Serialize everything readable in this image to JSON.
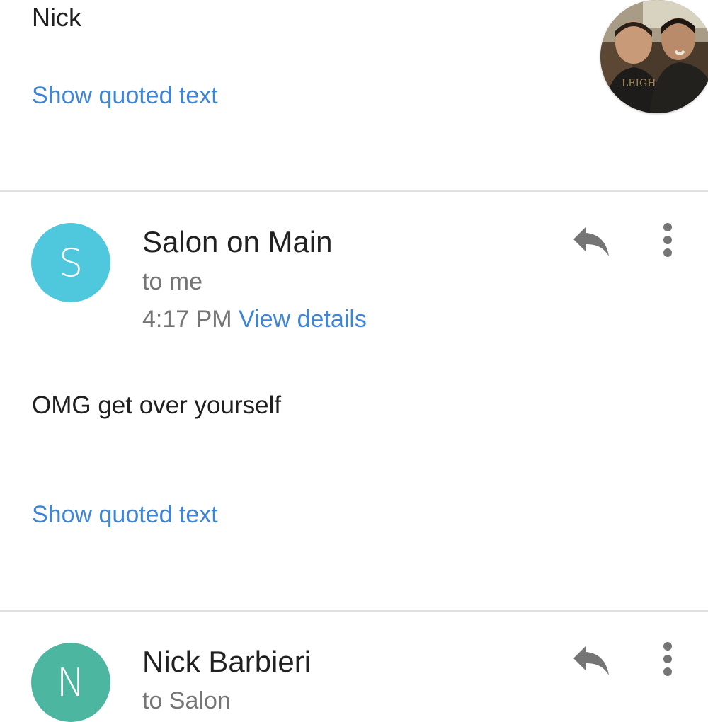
{
  "message1": {
    "signature": "Nick",
    "show_quoted": "Show quoted text"
  },
  "message2": {
    "avatar_letter": "S",
    "avatar_color": "#4fc7dd",
    "sender": "Salon on Main",
    "recipient": "to me",
    "time": "4:17 PM",
    "details_link": "View details",
    "body": "OMG get over yourself",
    "show_quoted": "Show quoted text"
  },
  "message3": {
    "avatar_letter": "N",
    "avatar_color": "#4db6a0",
    "sender": "Nick Barbieri",
    "recipient": "to Salon"
  },
  "colors": {
    "link": "#3d85d8",
    "meta_text": "#757575",
    "icon": "#757575",
    "divider": "#e0e0e0"
  },
  "icons": {
    "reply": "reply-icon",
    "more": "more-vert-icon"
  }
}
